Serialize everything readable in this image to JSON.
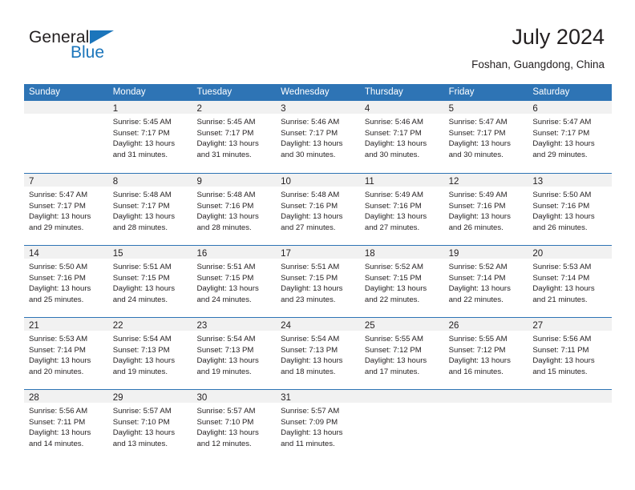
{
  "brand": {
    "name_part1": "General",
    "name_part2": "Blue"
  },
  "header": {
    "month_title": "July 2024",
    "location": "Foshan, Guangdong, China"
  },
  "colors": {
    "header_band": "#2e74b5",
    "brand_blue": "#1b75bb",
    "day_number_band": "#f1f1f1",
    "text": "#231f20"
  },
  "weekdays": [
    "Sunday",
    "Monday",
    "Tuesday",
    "Wednesday",
    "Thursday",
    "Friday",
    "Saturday"
  ],
  "weeks": [
    [
      {
        "day": "",
        "lines": [
          "",
          "",
          "",
          ""
        ]
      },
      {
        "day": "1",
        "lines": [
          "Sunrise: 5:45 AM",
          "Sunset: 7:17 PM",
          "Daylight: 13 hours",
          "and 31 minutes."
        ]
      },
      {
        "day": "2",
        "lines": [
          "Sunrise: 5:45 AM",
          "Sunset: 7:17 PM",
          "Daylight: 13 hours",
          "and 31 minutes."
        ]
      },
      {
        "day": "3",
        "lines": [
          "Sunrise: 5:46 AM",
          "Sunset: 7:17 PM",
          "Daylight: 13 hours",
          "and 30 minutes."
        ]
      },
      {
        "day": "4",
        "lines": [
          "Sunrise: 5:46 AM",
          "Sunset: 7:17 PM",
          "Daylight: 13 hours",
          "and 30 minutes."
        ]
      },
      {
        "day": "5",
        "lines": [
          "Sunrise: 5:47 AM",
          "Sunset: 7:17 PM",
          "Daylight: 13 hours",
          "and 30 minutes."
        ]
      },
      {
        "day": "6",
        "lines": [
          "Sunrise: 5:47 AM",
          "Sunset: 7:17 PM",
          "Daylight: 13 hours",
          "and 29 minutes."
        ]
      }
    ],
    [
      {
        "day": "7",
        "lines": [
          "Sunrise: 5:47 AM",
          "Sunset: 7:17 PM",
          "Daylight: 13 hours",
          "and 29 minutes."
        ]
      },
      {
        "day": "8",
        "lines": [
          "Sunrise: 5:48 AM",
          "Sunset: 7:17 PM",
          "Daylight: 13 hours",
          "and 28 minutes."
        ]
      },
      {
        "day": "9",
        "lines": [
          "Sunrise: 5:48 AM",
          "Sunset: 7:16 PM",
          "Daylight: 13 hours",
          "and 28 minutes."
        ]
      },
      {
        "day": "10",
        "lines": [
          "Sunrise: 5:48 AM",
          "Sunset: 7:16 PM",
          "Daylight: 13 hours",
          "and 27 minutes."
        ]
      },
      {
        "day": "11",
        "lines": [
          "Sunrise: 5:49 AM",
          "Sunset: 7:16 PM",
          "Daylight: 13 hours",
          "and 27 minutes."
        ]
      },
      {
        "day": "12",
        "lines": [
          "Sunrise: 5:49 AM",
          "Sunset: 7:16 PM",
          "Daylight: 13 hours",
          "and 26 minutes."
        ]
      },
      {
        "day": "13",
        "lines": [
          "Sunrise: 5:50 AM",
          "Sunset: 7:16 PM",
          "Daylight: 13 hours",
          "and 26 minutes."
        ]
      }
    ],
    [
      {
        "day": "14",
        "lines": [
          "Sunrise: 5:50 AM",
          "Sunset: 7:16 PM",
          "Daylight: 13 hours",
          "and 25 minutes."
        ]
      },
      {
        "day": "15",
        "lines": [
          "Sunrise: 5:51 AM",
          "Sunset: 7:15 PM",
          "Daylight: 13 hours",
          "and 24 minutes."
        ]
      },
      {
        "day": "16",
        "lines": [
          "Sunrise: 5:51 AM",
          "Sunset: 7:15 PM",
          "Daylight: 13 hours",
          "and 24 minutes."
        ]
      },
      {
        "day": "17",
        "lines": [
          "Sunrise: 5:51 AM",
          "Sunset: 7:15 PM",
          "Daylight: 13 hours",
          "and 23 minutes."
        ]
      },
      {
        "day": "18",
        "lines": [
          "Sunrise: 5:52 AM",
          "Sunset: 7:15 PM",
          "Daylight: 13 hours",
          "and 22 minutes."
        ]
      },
      {
        "day": "19",
        "lines": [
          "Sunrise: 5:52 AM",
          "Sunset: 7:14 PM",
          "Daylight: 13 hours",
          "and 22 minutes."
        ]
      },
      {
        "day": "20",
        "lines": [
          "Sunrise: 5:53 AM",
          "Sunset: 7:14 PM",
          "Daylight: 13 hours",
          "and 21 minutes."
        ]
      }
    ],
    [
      {
        "day": "21",
        "lines": [
          "Sunrise: 5:53 AM",
          "Sunset: 7:14 PM",
          "Daylight: 13 hours",
          "and 20 minutes."
        ]
      },
      {
        "day": "22",
        "lines": [
          "Sunrise: 5:54 AM",
          "Sunset: 7:13 PM",
          "Daylight: 13 hours",
          "and 19 minutes."
        ]
      },
      {
        "day": "23",
        "lines": [
          "Sunrise: 5:54 AM",
          "Sunset: 7:13 PM",
          "Daylight: 13 hours",
          "and 19 minutes."
        ]
      },
      {
        "day": "24",
        "lines": [
          "Sunrise: 5:54 AM",
          "Sunset: 7:13 PM",
          "Daylight: 13 hours",
          "and 18 minutes."
        ]
      },
      {
        "day": "25",
        "lines": [
          "Sunrise: 5:55 AM",
          "Sunset: 7:12 PM",
          "Daylight: 13 hours",
          "and 17 minutes."
        ]
      },
      {
        "day": "26",
        "lines": [
          "Sunrise: 5:55 AM",
          "Sunset: 7:12 PM",
          "Daylight: 13 hours",
          "and 16 minutes."
        ]
      },
      {
        "day": "27",
        "lines": [
          "Sunrise: 5:56 AM",
          "Sunset: 7:11 PM",
          "Daylight: 13 hours",
          "and 15 minutes."
        ]
      }
    ],
    [
      {
        "day": "28",
        "lines": [
          "Sunrise: 5:56 AM",
          "Sunset: 7:11 PM",
          "Daylight: 13 hours",
          "and 14 minutes."
        ]
      },
      {
        "day": "29",
        "lines": [
          "Sunrise: 5:57 AM",
          "Sunset: 7:10 PM",
          "Daylight: 13 hours",
          "and 13 minutes."
        ]
      },
      {
        "day": "30",
        "lines": [
          "Sunrise: 5:57 AM",
          "Sunset: 7:10 PM",
          "Daylight: 13 hours",
          "and 12 minutes."
        ]
      },
      {
        "day": "31",
        "lines": [
          "Sunrise: 5:57 AM",
          "Sunset: 7:09 PM",
          "Daylight: 13 hours",
          "and 11 minutes."
        ]
      },
      {
        "day": "",
        "lines": [
          "",
          "",
          "",
          ""
        ]
      },
      {
        "day": "",
        "lines": [
          "",
          "",
          "",
          ""
        ]
      },
      {
        "day": "",
        "lines": [
          "",
          "",
          "",
          ""
        ]
      }
    ]
  ]
}
